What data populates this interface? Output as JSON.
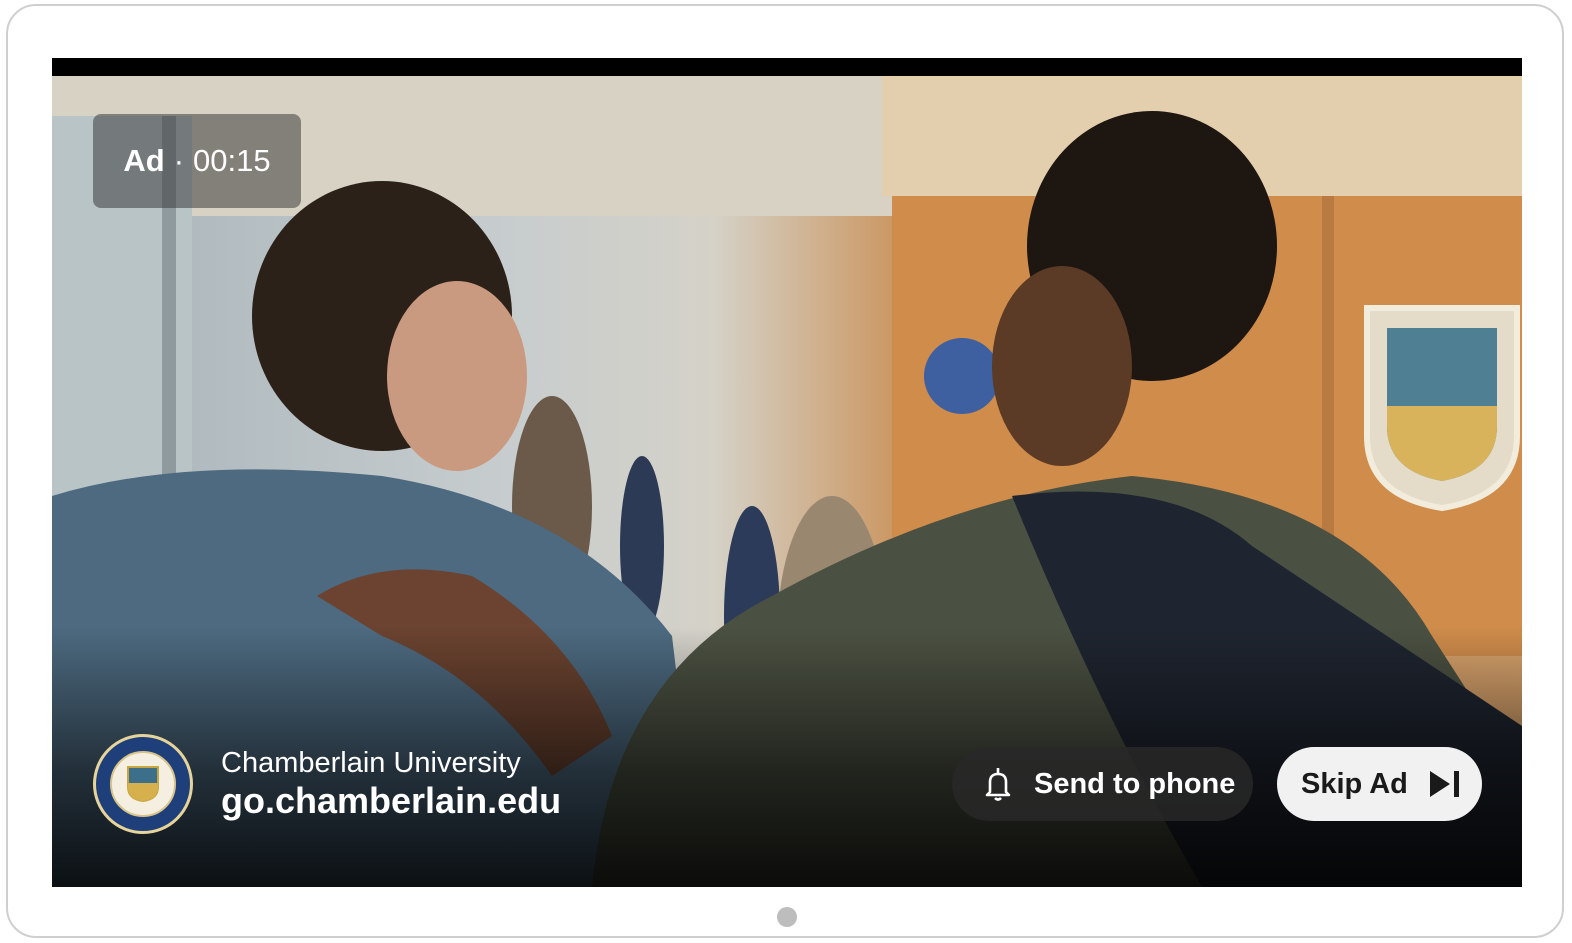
{
  "ad": {
    "label": "Ad",
    "separator": "·",
    "time_remaining": "00:15"
  },
  "advertiser": {
    "name": "Chamberlain University",
    "url": "go.chamberlain.edu",
    "logo_icon": "university-seal-icon"
  },
  "actions": {
    "send_to_phone_label": "Send to phone",
    "send_to_phone_icon": "bell-icon",
    "skip_ad_label": "Skip Ad",
    "skip_ad_icon": "skip-next-icon"
  },
  "colors": {
    "skip_button_bg": "#f1f1f1",
    "send_button_bg": "#282828",
    "text": "#ffffff"
  }
}
